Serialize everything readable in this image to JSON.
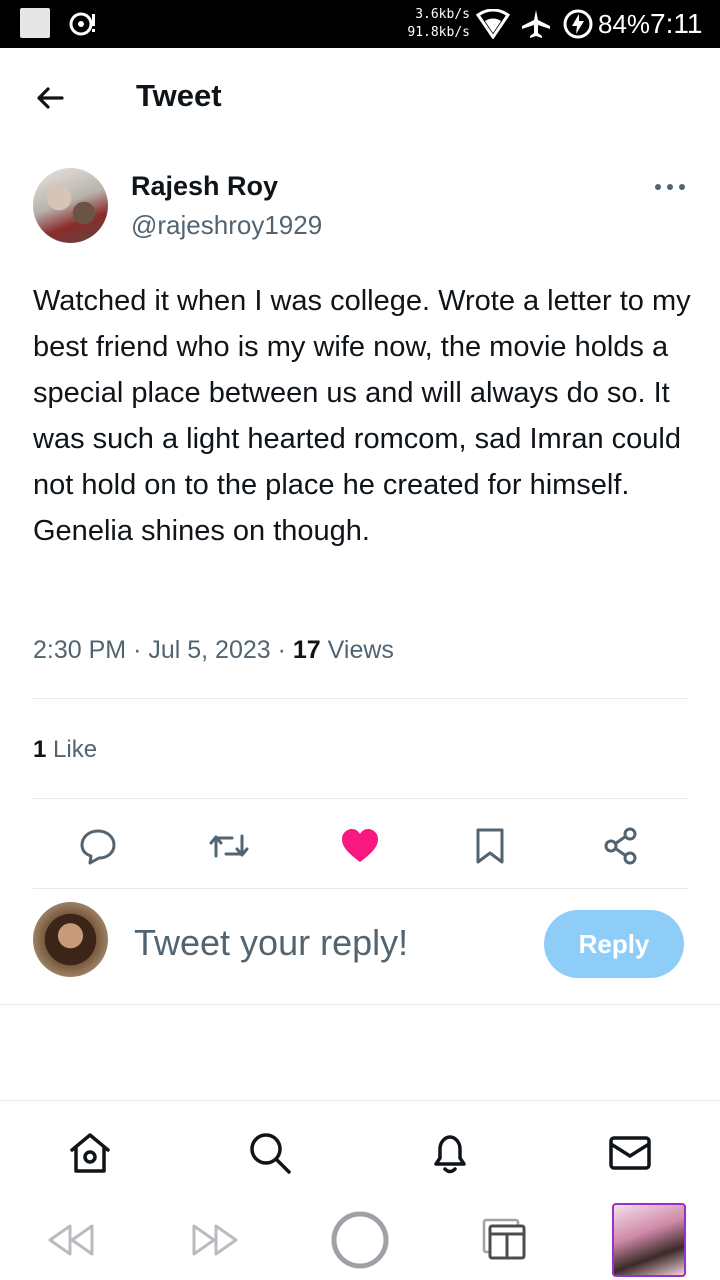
{
  "status_bar": {
    "speed_up": "3.6kb/s",
    "speed_down": "91.8kb/s",
    "battery": "84%",
    "time": "7:11"
  },
  "header": {
    "title": "Tweet"
  },
  "tweet": {
    "author_name": "Rajesh Roy",
    "author_handle": "@rajeshroy1929",
    "text": "Watched it when I was college. Wrote a letter to my best friend who is my wife now, the movie holds a special place between us and will always do so. It was such a light hearted romcom, sad Imran could not hold on to the place he created for himself. Genelia shines on though.",
    "time": "2:30 PM",
    "date": "Jul 5, 2023",
    "views_count": "17",
    "views_label": "Views",
    "likes_count": "1",
    "likes_label": "Like"
  },
  "actions": [
    "reply-icon",
    "retweet-icon",
    "like-icon",
    "bookmark-icon",
    "share-icon"
  ],
  "reply": {
    "placeholder": "Tweet your reply!",
    "button_label": "Reply"
  },
  "bottom_nav": [
    "home-icon",
    "search-icon",
    "notifications-icon",
    "messages-icon"
  ],
  "system_nav": [
    "rewind-icon",
    "fast-forward-icon",
    "loading-icon",
    "tabs-icon",
    "app-thumbnail"
  ],
  "colors": {
    "like": "#f91880",
    "reply_button": "#8ecdf8",
    "secondary_text": "#536471",
    "accent_border": "#9a2fd0"
  }
}
